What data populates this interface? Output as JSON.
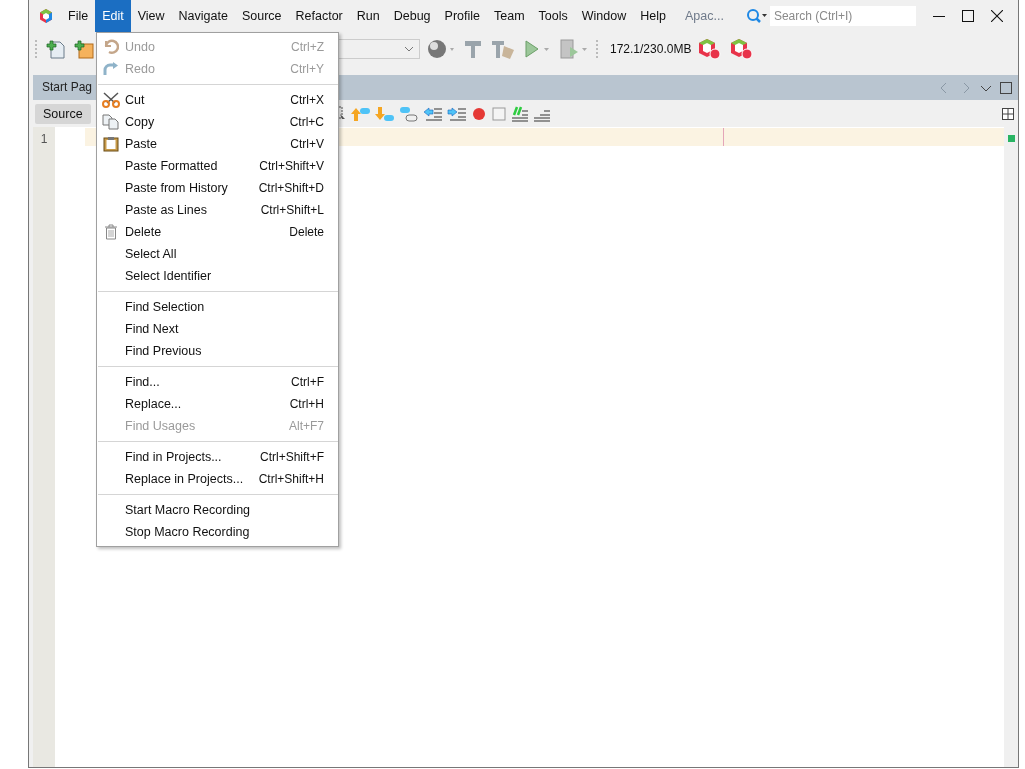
{
  "menubar": [
    {
      "label": "File",
      "selected": false
    },
    {
      "label": "Edit",
      "selected": true
    },
    {
      "label": "View",
      "selected": false
    },
    {
      "label": "Navigate",
      "selected": false
    },
    {
      "label": "Source",
      "selected": false
    },
    {
      "label": "Refactor",
      "selected": false
    },
    {
      "label": "Run",
      "selected": false
    },
    {
      "label": "Debug",
      "selected": false
    },
    {
      "label": "Profile",
      "selected": false
    },
    {
      "label": "Team",
      "selected": false
    },
    {
      "label": "Tools",
      "selected": false
    },
    {
      "label": "Window",
      "selected": false
    },
    {
      "label": "Help",
      "selected": false
    }
  ],
  "project_label": "Apac...",
  "search": {
    "placeholder": "Search (Ctrl+I)"
  },
  "toolbar": {
    "memory": "172.1/230.0MB"
  },
  "tabs": [
    {
      "label": "Start Pag"
    }
  ],
  "editor_tabs": [
    {
      "label": "Source",
      "selected": true
    }
  ],
  "editor": {
    "line_numbers": [
      "1"
    ]
  },
  "edit_menu": [
    [
      {
        "label": "Undo",
        "shortcut": "Ctrl+Z",
        "disabled": true
      },
      {
        "label": "Redo",
        "shortcut": "Ctrl+Y",
        "disabled": true
      }
    ],
    [
      {
        "label": "Cut",
        "shortcut": "Ctrl+X",
        "disabled": false
      },
      {
        "label": "Copy",
        "shortcut": "Ctrl+C",
        "disabled": false
      },
      {
        "label": "Paste",
        "shortcut": "Ctrl+V",
        "disabled": false
      },
      {
        "label": "Paste Formatted",
        "shortcut": "Ctrl+Shift+V",
        "disabled": false
      },
      {
        "label": "Paste from History",
        "shortcut": "Ctrl+Shift+D",
        "disabled": false
      },
      {
        "label": "Paste as Lines",
        "shortcut": "Ctrl+Shift+L",
        "disabled": false
      },
      {
        "label": "Delete",
        "shortcut": "Delete",
        "disabled": false
      },
      {
        "label": "Select All",
        "disabled": false
      },
      {
        "label": "Select Identifier",
        "disabled": false
      }
    ],
    [
      {
        "label": "Find Selection",
        "disabled": false
      },
      {
        "label": "Find Next",
        "disabled": false
      },
      {
        "label": "Find Previous",
        "disabled": false
      }
    ],
    [
      {
        "label": "Find...",
        "shortcut": "Ctrl+F",
        "disabled": false
      },
      {
        "label": "Replace...",
        "shortcut": "Ctrl+H",
        "disabled": false
      },
      {
        "label": "Find Usages",
        "shortcut": "Alt+F7",
        "disabled": true
      }
    ],
    [
      {
        "label": "Find in Projects...",
        "shortcut": "Ctrl+Shift+F",
        "disabled": false
      },
      {
        "label": "Replace in Projects...",
        "shortcut": "Ctrl+Shift+H",
        "disabled": false
      }
    ],
    [
      {
        "label": "Start Macro Recording",
        "disabled": false
      },
      {
        "label": "Stop Macro Recording",
        "disabled": false
      }
    ]
  ]
}
